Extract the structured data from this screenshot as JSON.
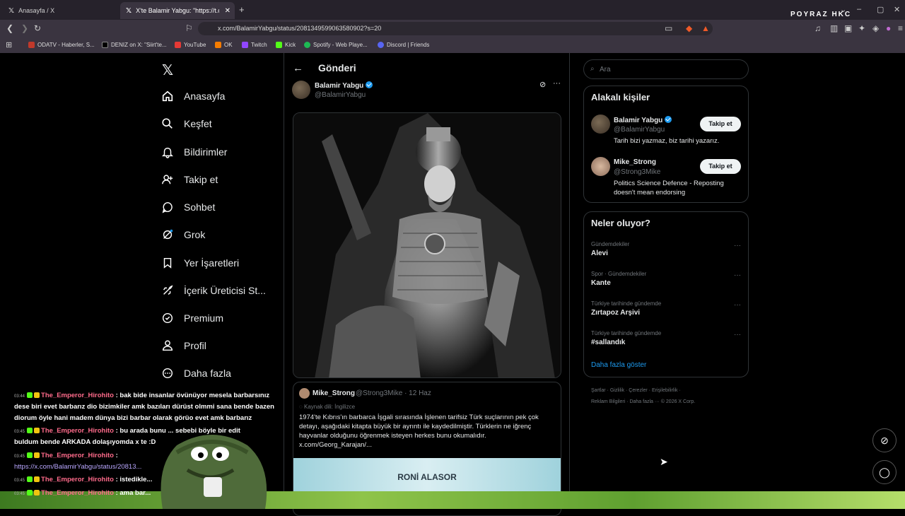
{
  "browser": {
    "tabs": [
      {
        "label": "Anasayfa / X"
      },
      {
        "label": "X'te Balamir Yabgu: \"https://t.co"
      }
    ],
    "brand": "POYRAZ HKC",
    "url": "x.com/BalamirYabgu/status/2081349599063580902?s=20",
    "bookmarks": [
      "ODATV - Haberler, S...",
      "DENIZ on X: \"Siirt'te...",
      "YouTube",
      "OK",
      "Twitch",
      "Kick",
      "Spotify - Web Playe...",
      "Discord | Friends"
    ]
  },
  "sidebar": {
    "items": [
      "Anasayfa",
      "Keşfet",
      "Bildirimler",
      "Takip et",
      "Sohbet",
      "Grok",
      "Yer İşaretleri",
      "İçerik Üreticisi St...",
      "Premium",
      "Profil",
      "Daha fazla"
    ]
  },
  "post": {
    "page_title": "Gönderi",
    "author_name": "Balamir Yabgu",
    "author_handle": "@BalamirYabgu",
    "quote": {
      "name": "Mike_Strong",
      "meta": "@Strong3Mike · 12 Haz",
      "source": "Kaynak dili: İngilizce",
      "text": "1974'te Kıbrıs'ın barbarca İşgali sırasında İşlenen tarifsiz Türk suçlarının pek çok detayı, aşağıdaki kitapta büyük bir ayrıntı ile kaydedilmiştir. Türklerin ne iğrenç hayvanlar olduğunu öğrenmek isteyen herkes bunu okumalıdır. x.com/Georg_Karajan/...",
      "banner": "RONİ ALASOR"
    }
  },
  "right": {
    "search_placeholder": "Ara",
    "related_title": "Alakalı kişiler",
    "people": [
      {
        "name": "Balamir Yabgu",
        "handle": "@BalamirYabgu",
        "bio": "Tarih bizi yazmaz, biz tarihi yazarız.",
        "follow": "Takip et"
      },
      {
        "name": "Mike_Strong",
        "handle": "@Strong3Mike",
        "bio": "Politics Science Defence - Reposting doesn't mean endorsing",
        "follow": "Takip et"
      }
    ],
    "trends_title": "Neler oluyor?",
    "trends": [
      {
        "cat": "Gündemdekiler",
        "name": "Alevi"
      },
      {
        "cat": "Spor · Gündemdekiler",
        "name": "Kante"
      },
      {
        "cat": "Türkiye tarihinde gündemde",
        "name": "Zırtapoz Arşivi"
      },
      {
        "cat": "Türkiye tarihinde gündemde",
        "name": "#sallandık"
      }
    ],
    "show_more": "Daha fazla göster",
    "footer1": "Şartlar · Gizlilik · Çerezler · Erişilebilirlik ·",
    "footer2": "Reklam Bilgileri · Daha fazla ··· © 2026 X Corp."
  },
  "chat": {
    "lines": [
      {
        "ts": "03:44",
        "user": "The_Emperor_Hirohito",
        "text": ": bak bide insanlar övünüyor mesela barbarsınız"
      },
      {
        "ts": "",
        "user": "",
        "text": "dese biri evet barbarız dio bizimkiler amk bazıları dürüst olmmi sana bende bazen"
      },
      {
        "ts": "",
        "user": "",
        "text": "diorum öyle hani madem dünya bizi barbar olarak görüo evet amk barbarız"
      },
      {
        "ts": "03:45",
        "user": "The_Emperor_Hirohito",
        "text": ": bu arada bunu ... sebebi böyle bir edit"
      },
      {
        "ts": "",
        "user": "",
        "text": "buldum bende ARKADA dolaşıyomda x te :D"
      },
      {
        "ts": "03:45",
        "user": "The_Emperor_Hirohito",
        "text": ":"
      },
      {
        "ts": "",
        "user": "",
        "text": "https://x.com/BalamirYabgu/status/20813..."
      },
      {
        "ts": "03:45",
        "user": "The_Emperor_Hirohito",
        "text": ": istedikle..."
      },
      {
        "ts": "03:45",
        "user": "The_Emperor_Hirohito",
        "text": ": ama bar..."
      }
    ]
  }
}
